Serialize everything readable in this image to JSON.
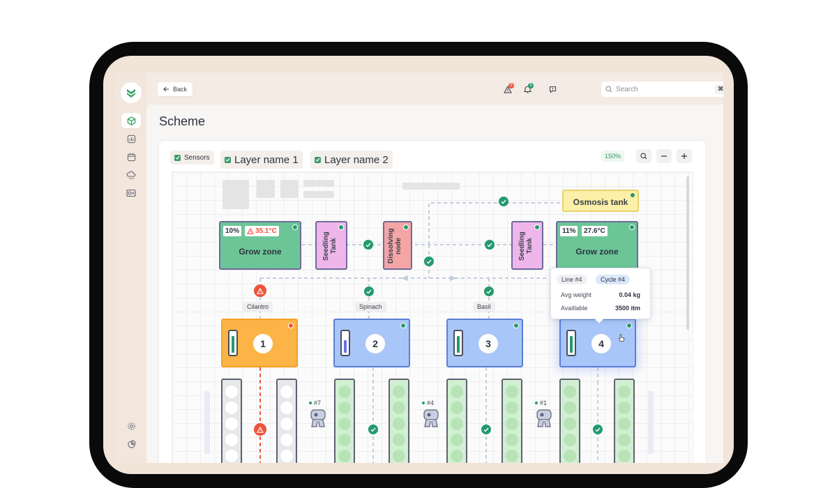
{
  "topbar": {
    "back_label": "Back",
    "alerts_count": "5",
    "notifications_count": "5",
    "search_placeholder": "Search",
    "search_shortcut": "⌘ + N"
  },
  "page": {
    "title": "Scheme"
  },
  "layers": [
    {
      "label": "Sensors",
      "checked": true
    },
    {
      "label": "Layer name 1",
      "checked": true
    },
    {
      "label": "Layer name 2",
      "checked": true
    }
  ],
  "zoom": {
    "level": "150%"
  },
  "nodes": {
    "osmosis": "Osmosis tank",
    "grow_zone_left": {
      "label": "Grow zone",
      "humidity": "10%",
      "temperature": "35.1°C",
      "alert": true
    },
    "grow_zone_right": {
      "label": "Grow zone",
      "humidity": "11%",
      "temperature": "27.6°C"
    },
    "seedling_left": "Seedling Tank",
    "dissolving": "Dissolving node",
    "seedling_right": "Seedling Tank"
  },
  "lines": [
    {
      "label": "Cilantro",
      "number": "1",
      "level": 0.85,
      "status": "alert"
    },
    {
      "label": "Spinach",
      "number": "2",
      "level": 0.65,
      "status": "ok"
    },
    {
      "label": "Basil",
      "number": "3",
      "level": 0.85,
      "status": "ok"
    },
    {
      "label": "",
      "number": "4",
      "level": 0.85,
      "status": "ok"
    }
  ],
  "robots": [
    {
      "label": "#7"
    },
    {
      "label": "#4"
    },
    {
      "label": "#1"
    }
  ],
  "tooltip": {
    "line": "Line #4",
    "cycle": "Cycle #4",
    "avg_weight_label": "Avg weight",
    "avg_weight_value": "0.04 kg",
    "available_label": "Availlable",
    "available_value": "3500 itm"
  },
  "colors": {
    "grow_zone": "#6cc596",
    "seedling": "#eeb6ea",
    "dissolving": "#f4a5a6",
    "osmosis": "#fcf0a8",
    "tank_orange": "#fbb445",
    "tank_blue": "#a9c6f8",
    "ok_green": "#239a6e",
    "alert_red": "#f0523a"
  }
}
